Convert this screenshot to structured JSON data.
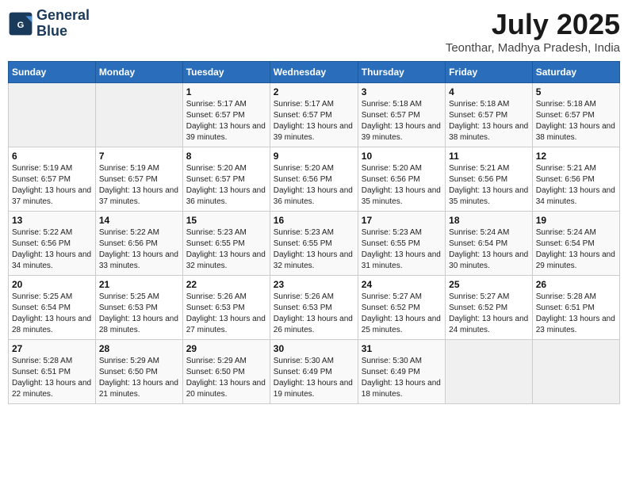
{
  "header": {
    "logo_line1": "General",
    "logo_line2": "Blue",
    "month_year": "July 2025",
    "location": "Teonthar, Madhya Pradesh, India"
  },
  "columns": [
    "Sunday",
    "Monday",
    "Tuesday",
    "Wednesday",
    "Thursday",
    "Friday",
    "Saturday"
  ],
  "weeks": [
    [
      {
        "num": "",
        "sunrise": "",
        "sunset": "",
        "daylight": ""
      },
      {
        "num": "",
        "sunrise": "",
        "sunset": "",
        "daylight": ""
      },
      {
        "num": "1",
        "sunrise": "Sunrise: 5:17 AM",
        "sunset": "Sunset: 6:57 PM",
        "daylight": "Daylight: 13 hours and 39 minutes."
      },
      {
        "num": "2",
        "sunrise": "Sunrise: 5:17 AM",
        "sunset": "Sunset: 6:57 PM",
        "daylight": "Daylight: 13 hours and 39 minutes."
      },
      {
        "num": "3",
        "sunrise": "Sunrise: 5:18 AM",
        "sunset": "Sunset: 6:57 PM",
        "daylight": "Daylight: 13 hours and 39 minutes."
      },
      {
        "num": "4",
        "sunrise": "Sunrise: 5:18 AM",
        "sunset": "Sunset: 6:57 PM",
        "daylight": "Daylight: 13 hours and 38 minutes."
      },
      {
        "num": "5",
        "sunrise": "Sunrise: 5:18 AM",
        "sunset": "Sunset: 6:57 PM",
        "daylight": "Daylight: 13 hours and 38 minutes."
      }
    ],
    [
      {
        "num": "6",
        "sunrise": "Sunrise: 5:19 AM",
        "sunset": "Sunset: 6:57 PM",
        "daylight": "Daylight: 13 hours and 37 minutes."
      },
      {
        "num": "7",
        "sunrise": "Sunrise: 5:19 AM",
        "sunset": "Sunset: 6:57 PM",
        "daylight": "Daylight: 13 hours and 37 minutes."
      },
      {
        "num": "8",
        "sunrise": "Sunrise: 5:20 AM",
        "sunset": "Sunset: 6:57 PM",
        "daylight": "Daylight: 13 hours and 36 minutes."
      },
      {
        "num": "9",
        "sunrise": "Sunrise: 5:20 AM",
        "sunset": "Sunset: 6:56 PM",
        "daylight": "Daylight: 13 hours and 36 minutes."
      },
      {
        "num": "10",
        "sunrise": "Sunrise: 5:20 AM",
        "sunset": "Sunset: 6:56 PM",
        "daylight": "Daylight: 13 hours and 35 minutes."
      },
      {
        "num": "11",
        "sunrise": "Sunrise: 5:21 AM",
        "sunset": "Sunset: 6:56 PM",
        "daylight": "Daylight: 13 hours and 35 minutes."
      },
      {
        "num": "12",
        "sunrise": "Sunrise: 5:21 AM",
        "sunset": "Sunset: 6:56 PM",
        "daylight": "Daylight: 13 hours and 34 minutes."
      }
    ],
    [
      {
        "num": "13",
        "sunrise": "Sunrise: 5:22 AM",
        "sunset": "Sunset: 6:56 PM",
        "daylight": "Daylight: 13 hours and 34 minutes."
      },
      {
        "num": "14",
        "sunrise": "Sunrise: 5:22 AM",
        "sunset": "Sunset: 6:56 PM",
        "daylight": "Daylight: 13 hours and 33 minutes."
      },
      {
        "num": "15",
        "sunrise": "Sunrise: 5:23 AM",
        "sunset": "Sunset: 6:55 PM",
        "daylight": "Daylight: 13 hours and 32 minutes."
      },
      {
        "num": "16",
        "sunrise": "Sunrise: 5:23 AM",
        "sunset": "Sunset: 6:55 PM",
        "daylight": "Daylight: 13 hours and 32 minutes."
      },
      {
        "num": "17",
        "sunrise": "Sunrise: 5:23 AM",
        "sunset": "Sunset: 6:55 PM",
        "daylight": "Daylight: 13 hours and 31 minutes."
      },
      {
        "num": "18",
        "sunrise": "Sunrise: 5:24 AM",
        "sunset": "Sunset: 6:54 PM",
        "daylight": "Daylight: 13 hours and 30 minutes."
      },
      {
        "num": "19",
        "sunrise": "Sunrise: 5:24 AM",
        "sunset": "Sunset: 6:54 PM",
        "daylight": "Daylight: 13 hours and 29 minutes."
      }
    ],
    [
      {
        "num": "20",
        "sunrise": "Sunrise: 5:25 AM",
        "sunset": "Sunset: 6:54 PM",
        "daylight": "Daylight: 13 hours and 28 minutes."
      },
      {
        "num": "21",
        "sunrise": "Sunrise: 5:25 AM",
        "sunset": "Sunset: 6:53 PM",
        "daylight": "Daylight: 13 hours and 28 minutes."
      },
      {
        "num": "22",
        "sunrise": "Sunrise: 5:26 AM",
        "sunset": "Sunset: 6:53 PM",
        "daylight": "Daylight: 13 hours and 27 minutes."
      },
      {
        "num": "23",
        "sunrise": "Sunrise: 5:26 AM",
        "sunset": "Sunset: 6:53 PM",
        "daylight": "Daylight: 13 hours and 26 minutes."
      },
      {
        "num": "24",
        "sunrise": "Sunrise: 5:27 AM",
        "sunset": "Sunset: 6:52 PM",
        "daylight": "Daylight: 13 hours and 25 minutes."
      },
      {
        "num": "25",
        "sunrise": "Sunrise: 5:27 AM",
        "sunset": "Sunset: 6:52 PM",
        "daylight": "Daylight: 13 hours and 24 minutes."
      },
      {
        "num": "26",
        "sunrise": "Sunrise: 5:28 AM",
        "sunset": "Sunset: 6:51 PM",
        "daylight": "Daylight: 13 hours and 23 minutes."
      }
    ],
    [
      {
        "num": "27",
        "sunrise": "Sunrise: 5:28 AM",
        "sunset": "Sunset: 6:51 PM",
        "daylight": "Daylight: 13 hours and 22 minutes."
      },
      {
        "num": "28",
        "sunrise": "Sunrise: 5:29 AM",
        "sunset": "Sunset: 6:50 PM",
        "daylight": "Daylight: 13 hours and 21 minutes."
      },
      {
        "num": "29",
        "sunrise": "Sunrise: 5:29 AM",
        "sunset": "Sunset: 6:50 PM",
        "daylight": "Daylight: 13 hours and 20 minutes."
      },
      {
        "num": "30",
        "sunrise": "Sunrise: 5:30 AM",
        "sunset": "Sunset: 6:49 PM",
        "daylight": "Daylight: 13 hours and 19 minutes."
      },
      {
        "num": "31",
        "sunrise": "Sunrise: 5:30 AM",
        "sunset": "Sunset: 6:49 PM",
        "daylight": "Daylight: 13 hours and 18 minutes."
      },
      {
        "num": "",
        "sunrise": "",
        "sunset": "",
        "daylight": ""
      },
      {
        "num": "",
        "sunrise": "",
        "sunset": "",
        "daylight": ""
      }
    ]
  ]
}
